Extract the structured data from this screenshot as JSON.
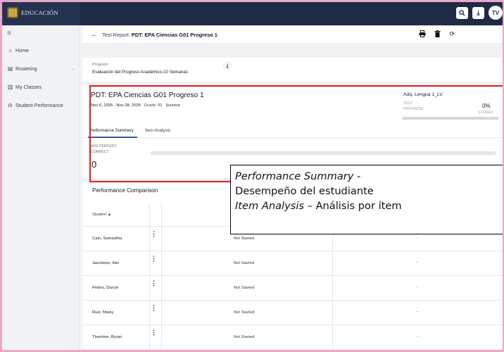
{
  "topbar": {
    "brand_text": "EDUCACIÓN",
    "search_icon": "🔍",
    "download_icon": "⤓",
    "avatar_initials": "TV"
  },
  "sidebar": {
    "menu_icon": "≡",
    "items": [
      {
        "label": "Home",
        "icon": "⌂"
      },
      {
        "label": "Rostering",
        "icon": "▤",
        "chevron": "⌄"
      },
      {
        "label": "My Classes",
        "icon": "▥"
      },
      {
        "label": "Student Performance",
        "icon": "ılı"
      }
    ]
  },
  "header": {
    "back_icon": "←",
    "prefix": "Test Report: ",
    "title": "PDT: EPA Ciencias G01 Progreso 1",
    "print_icon": "⎙",
    "delete_icon": "🗑",
    "refresh_icon": "⟳"
  },
  "program": {
    "label": "Program:",
    "value": "Evaluación del Progreso Académico-10 Semanas",
    "info_icon": "i"
  },
  "test_card": {
    "title": "PDT: EPA Ciencias G01 Progreso 1",
    "dates": "Nov 6, 2025 - Nov 28, 2025",
    "grade_label": "Grade:",
    "grade_value": "01",
    "subject": "Science",
    "adq": "Adq. Lengua 1_LV",
    "test_label": "TEST",
    "progress_label": "PROGRESS",
    "percent": "0%",
    "scored": "SCORED",
    "progress_fraction": 0,
    "tabs": [
      "Performance Summary",
      "Item Analysis"
    ],
    "avg_label_1": "AVG PERCENT",
    "avg_label_2": "CORRECT",
    "avg_value": "0"
  },
  "comparison": {
    "title": "Performance Comparison",
    "student_header": "Student ▲",
    "rows": [
      {
        "name": "Cain, Samantha",
        "status": "Not Started",
        "score": "-"
      },
      {
        "name": "Jacobson, Ifan",
        "status": "Not Started",
        "score": "-"
      },
      {
        "name": "Peters, Darcie",
        "status": "Not Started",
        "score": "-"
      },
      {
        "name": "Ruiz, Maisy",
        "status": "Not Started",
        "score": "-"
      },
      {
        "name": "Thornton, Bryan",
        "status": "Not Started",
        "score": "-"
      }
    ],
    "kebab_icon": "⋮"
  },
  "annotation": {
    "line1_italic": "Performance Summary",
    "line1_rest": " -",
    "line2": "Desempeño del estudiante",
    "line3_italic": "Item Analysis",
    "line3_rest": " – Análisis por ítem"
  },
  "colors": {
    "topbar": "#1f2a44",
    "highlight_border": "#e21b23",
    "tab_accent": "#2f5a9e",
    "frame": "#e9a9c4"
  }
}
